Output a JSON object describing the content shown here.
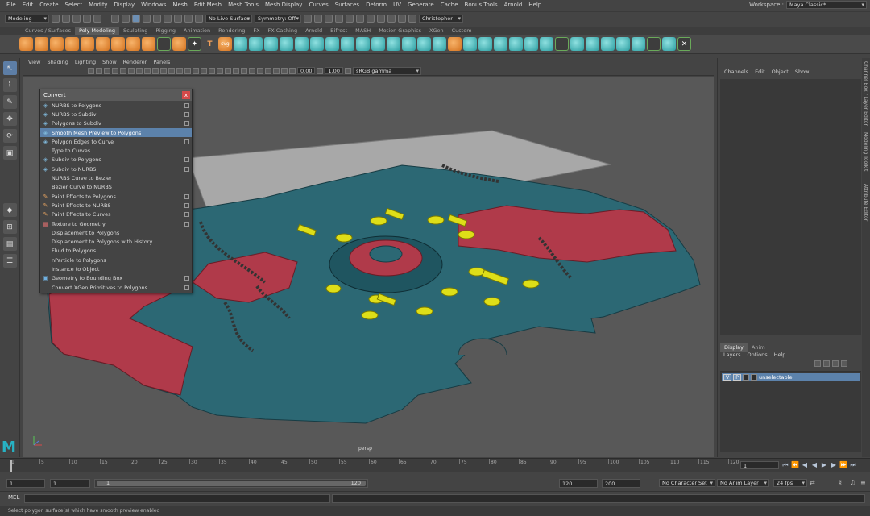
{
  "menubar": {
    "items": [
      "File",
      "Edit",
      "Create",
      "Select",
      "Modify",
      "Display",
      "Windows",
      "Mesh",
      "Edit Mesh",
      "Mesh Tools",
      "Mesh Display",
      "Curves",
      "Surfaces",
      "Deform",
      "UV",
      "Generate",
      "Cache",
      "Bonus Tools",
      "Arnold",
      "Help"
    ],
    "workspace_label": "Workspace :",
    "workspace_value": "Maya Classic*"
  },
  "statusline": {
    "mode": "Modeling",
    "live_surface": "No Live Surface",
    "symmetry": "Symmetry: Off",
    "user": "Christopher"
  },
  "shelf_tabs": [
    "Curves / Surfaces",
    "Poly Modeling",
    "Sculpting",
    "Rigging",
    "Animation",
    "Rendering",
    "FX",
    "FX Caching",
    "Arnold",
    "Bifrost",
    "MASH",
    "Motion Graphics",
    "XGen",
    "Custom"
  ],
  "shelf_active": "Poly Modeling",
  "viewport": {
    "menu": [
      "View",
      "Shading",
      "Lighting",
      "Show",
      "Renderer",
      "Panels"
    ],
    "exposure": "0.00",
    "gamma": "1.00",
    "colorspace": "sRGB gamma",
    "camera_label": "persp"
  },
  "convert_menu": {
    "title": "Convert",
    "close": "x",
    "items": [
      {
        "label": "NURBS to Polygons",
        "icon": "nurbs-poly-icon",
        "option": true,
        "highlight": false
      },
      {
        "label": "NURBS to Subdiv",
        "icon": "nurbs-subdiv-icon",
        "option": true,
        "highlight": false
      },
      {
        "label": "Polygons to Subdiv",
        "icon": "poly-subdiv-icon",
        "option": true,
        "highlight": false
      },
      {
        "label": "Smooth Mesh Preview to Polygons",
        "icon": "smooth-mesh-icon",
        "option": false,
        "highlight": true
      },
      {
        "label": "Polygon Edges to Curve",
        "icon": "edge-curve-icon",
        "option": true,
        "highlight": false
      },
      {
        "label": "Type to Curves",
        "icon": "",
        "option": false,
        "highlight": false
      },
      {
        "label": "Subdiv to Polygons",
        "icon": "subdiv-poly-icon",
        "option": true,
        "highlight": false
      },
      {
        "label": "Subdiv to NURBS",
        "icon": "subdiv-nurbs-icon",
        "option": true,
        "highlight": false
      },
      {
        "label": "NURBS Curve to Bezier",
        "icon": "",
        "option": false,
        "highlight": false
      },
      {
        "label": "Bezier Curve to NURBS",
        "icon": "",
        "option": false,
        "highlight": false
      },
      {
        "label": "Paint Effects to Polygons",
        "icon": "paint-brush-icon",
        "option": true,
        "highlight": false
      },
      {
        "label": "Paint Effects to NURBS",
        "icon": "paint-brush-icon",
        "option": true,
        "highlight": false
      },
      {
        "label": "Paint Effects to Curves",
        "icon": "paint-brush-icon",
        "option": true,
        "highlight": false
      },
      {
        "label": "Texture to Geometry",
        "icon": "texture-icon",
        "option": true,
        "highlight": false
      },
      {
        "label": "Displacement to Polygons",
        "icon": "",
        "option": false,
        "highlight": false
      },
      {
        "label": "Displacement to Polygons with History",
        "icon": "",
        "option": false,
        "highlight": false
      },
      {
        "label": "Fluid to Polygons",
        "icon": "",
        "option": false,
        "highlight": false
      },
      {
        "label": "nParticle to Polygons",
        "icon": "",
        "option": false,
        "highlight": false
      },
      {
        "label": "Instance to Object",
        "icon": "",
        "option": false,
        "highlight": false
      },
      {
        "label": "Geometry to Bounding Box",
        "icon": "bbox-icon",
        "option": true,
        "highlight": false
      },
      {
        "label": "Convert XGen Primitives to Polygons",
        "icon": "",
        "option": true,
        "highlight": false
      }
    ]
  },
  "channel_box": {
    "menu": [
      "Channels",
      "Edit",
      "Object",
      "Show"
    ]
  },
  "layer_editor": {
    "tabs": [
      "Display",
      "Anim"
    ],
    "active_tab": "Display",
    "menu": [
      "Layers",
      "Options",
      "Help"
    ],
    "layer": {
      "v": "V",
      "p": "P",
      "name": "unselectable"
    }
  },
  "side_tabs": [
    "Channel Box / Layer Editor",
    "Modeling Toolkit",
    "Attribute Editor"
  ],
  "timeline": {
    "ticks": [
      "1",
      "5",
      "10",
      "15",
      "20",
      "25",
      "30",
      "35",
      "40",
      "45",
      "50",
      "55",
      "60",
      "65",
      "70",
      "75",
      "80",
      "85",
      "90",
      "95",
      "100",
      "105",
      "110",
      "115",
      "120"
    ],
    "current_frame": "1"
  },
  "range": {
    "start": "1",
    "playback_start": "1",
    "slider_start": "1",
    "slider_end": "120",
    "playback_end": "120",
    "end": "200",
    "character_set": "No Character Set",
    "anim_layer": "No Anim Layer",
    "fps": "24 fps"
  },
  "command_line": {
    "label": "MEL"
  },
  "help_line": "Select polygon surface(s) which have smooth preview enabled"
}
